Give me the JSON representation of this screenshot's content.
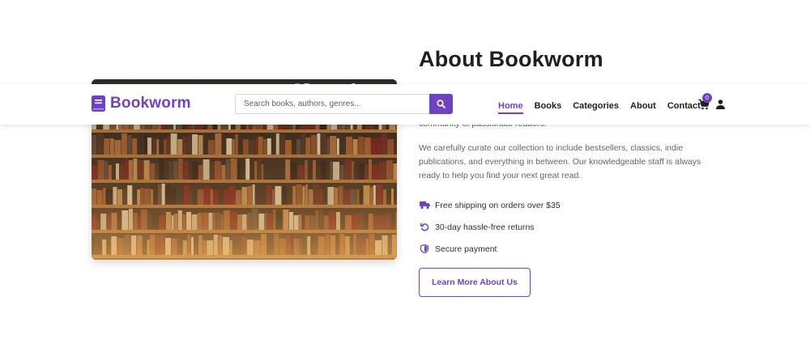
{
  "header": {
    "brand": "Bookworm",
    "search_placeholder": "Search books, authors, genres...",
    "nav": [
      {
        "label": "Home",
        "active": true
      },
      {
        "label": "Books"
      },
      {
        "label": "Categories"
      },
      {
        "label": "About"
      },
      {
        "label": "Contact"
      }
    ],
    "cart_count": "0",
    "accent_color": "#6f42c1"
  },
  "about": {
    "title": "About Bookworm",
    "paragraph1": "community of passionate readers.",
    "paragraph2": "We carefully curate our collection to include bestsellers, classics, indie publications, and everything in between. Our knowledgeable staff is always ready to help you find your next great read.",
    "features": [
      {
        "icon": "truck-icon",
        "text": "Free shipping on orders over $35"
      },
      {
        "icon": "return-icon",
        "text": "30-day hassle-free returns"
      },
      {
        "icon": "shield-icon",
        "text": "Secure payment"
      }
    ],
    "button_label": "Learn More About Us"
  }
}
